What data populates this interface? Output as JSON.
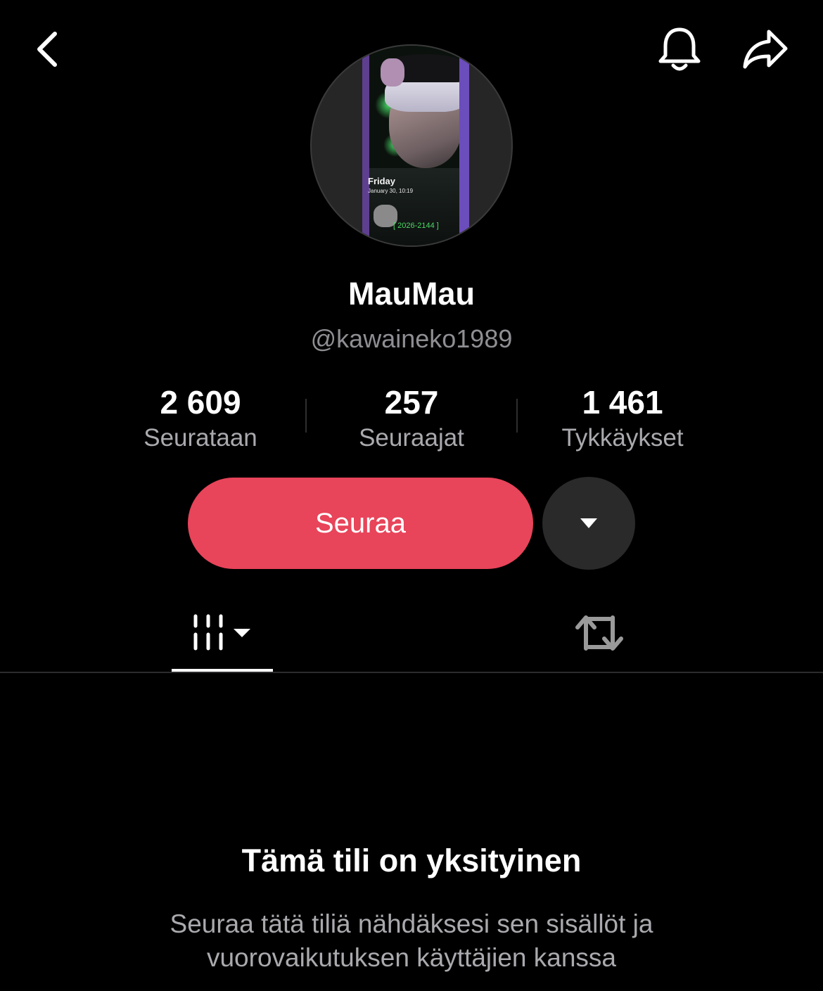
{
  "header": {
    "back_icon": "chevron-left-icon",
    "bell_icon": "bell-icon",
    "share_icon": "share-arrow-icon"
  },
  "profile": {
    "avatar_text": {
      "day": "Friday",
      "date": "January 30, 10:19",
      "code": "[ 2026-2144 ]"
    },
    "display_name": "MauMau",
    "username": "@kawaineko1989"
  },
  "stats": [
    {
      "value": "2 609",
      "label": "Seurataan"
    },
    {
      "value": "257",
      "label": "Seuraajat"
    },
    {
      "value": "1 461",
      "label": "Tykkäykset"
    }
  ],
  "actions": {
    "follow_label": "Seuraa",
    "more_icon": "caret-down-icon"
  },
  "tabs": {
    "videos_icon": "video-grid-icon",
    "reposts_icon": "repost-icon",
    "active": "videos"
  },
  "private_notice": {
    "title": "Tämä tili on yksityinen",
    "description": "Seuraa tätä tiliä nähdäksesi sen sisällöt ja vuorovaikutuksen käyttäjien kanssa"
  },
  "colors": {
    "background": "#000000",
    "follow_button": "#e8445a",
    "secondary_text": "#a9a9ae",
    "circle_button": "#2a2a2a"
  }
}
